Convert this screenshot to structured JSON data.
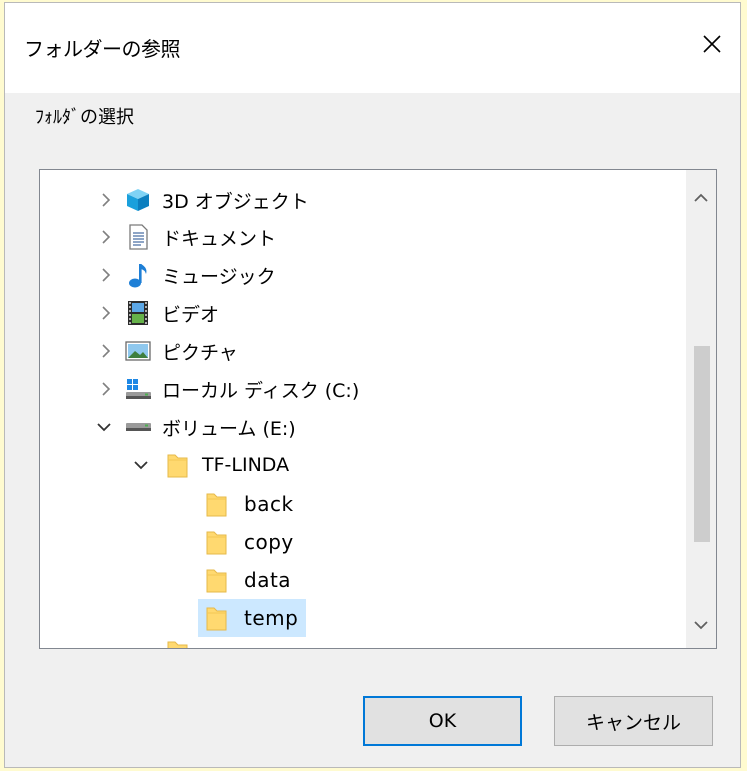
{
  "dialog": {
    "title": "フォルダーの参照",
    "prompt": "ﾌｫﾙﾀﾞの選択"
  },
  "tree": {
    "items": [
      {
        "label": "3D オブジェクト",
        "icon": "3d-objects-icon",
        "expanded": false
      },
      {
        "label": "ドキュメント",
        "icon": "documents-icon",
        "expanded": false
      },
      {
        "label": "ミュージック",
        "icon": "music-icon",
        "expanded": false
      },
      {
        "label": "ビデオ",
        "icon": "videos-icon",
        "expanded": false
      },
      {
        "label": "ピクチャ",
        "icon": "pictures-icon",
        "expanded": false
      },
      {
        "label": "ローカル ディスク (C:)",
        "icon": "local-disk-icon",
        "expanded": false
      },
      {
        "label": "ボリューム (E:)",
        "icon": "drive-icon",
        "expanded": true
      },
      {
        "label": "TF-LINDA",
        "icon": "folder-icon",
        "expanded": true
      },
      {
        "label": "back",
        "icon": "folder-icon"
      },
      {
        "label": "copy",
        "icon": "folder-icon"
      },
      {
        "label": "data",
        "icon": "folder-icon"
      },
      {
        "label": "temp",
        "icon": "folder-icon",
        "selected": true
      }
    ]
  },
  "buttons": {
    "ok": "OK",
    "cancel": "キャンセル"
  },
  "colors": {
    "selection": "#cce8ff",
    "accent": "#0078d7",
    "folder": "#ffd970"
  }
}
